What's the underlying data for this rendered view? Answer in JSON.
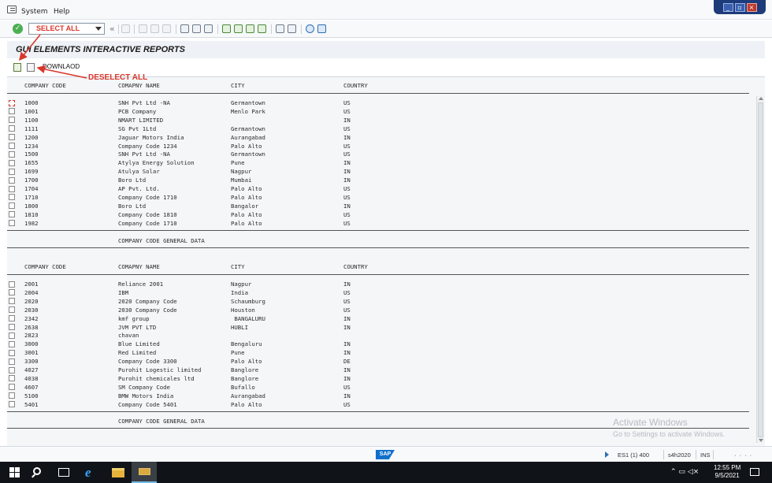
{
  "menu": {
    "items": [
      "System",
      "Help"
    ]
  },
  "toolbar": {
    "command_field_value": "SELECT ALL"
  },
  "title": "GUI ELEMENTS INTERACTIVE REPORTS",
  "app_toolbar": {
    "download_label": "DOWNLAOD"
  },
  "annotations": {
    "select_all": "SELECT ALL",
    "deselect_all": "DESELECT ALL"
  },
  "report": {
    "headers": [
      "COMPANY CODE",
      "COMAPNY NAME",
      "CITY",
      "COUNTRY"
    ],
    "section_label": "COMPANY CODE GENERAL DATA",
    "block1": [
      [
        "1000",
        "SNH Pvt Ltd -NA",
        "Germantown",
        "US"
      ],
      [
        "1001",
        "PCB Company",
        "Menlo Park",
        "US"
      ],
      [
        "1100",
        "NMART LIMITED",
        "",
        "IN"
      ],
      [
        "1111",
        "SG Pvt 1Ltd",
        "Germantown",
        "US"
      ],
      [
        "1200",
        "Jaguar Motors India",
        "Aurangabad",
        "IN"
      ],
      [
        "1234",
        "Company Code 1234",
        "Palo Alto",
        "US"
      ],
      [
        "1500",
        "SNH Pvt Ltd -NA",
        "Germantown",
        "US"
      ],
      [
        "1655",
        "Atylya Energy Solution",
        "Pune",
        "IN"
      ],
      [
        "1699",
        "Atulya Solar",
        "Nagpur",
        "IN"
      ],
      [
        "1700",
        "Boro Ltd",
        "Mumbai",
        "IN"
      ],
      [
        "1704",
        "AP Pvt. Ltd.",
        "Palo Alto",
        "US"
      ],
      [
        "1710",
        "Company Code 1710",
        "Palo Alto",
        "US"
      ],
      [
        "1800",
        "Boro Ltd",
        "Bangalor",
        "IN"
      ],
      [
        "1810",
        "Company Code 1810",
        "Palo Alto",
        "US"
      ],
      [
        "1982",
        "Company Code 1710",
        "Palo Alto",
        "US"
      ]
    ],
    "block2": [
      [
        "2001",
        "Reliance 2001",
        "Nagpur",
        "IN"
      ],
      [
        "2004",
        "IBM",
        "India",
        "US"
      ],
      [
        "2020",
        "2020 Company Code",
        "Schaumburg",
        "US"
      ],
      [
        "2030",
        "2030 Company Code",
        "Houston",
        "US"
      ],
      [
        "2342",
        "kmf group",
        " BANGALURU",
        "IN"
      ],
      [
        "2638",
        "JVM PVT LTD",
        "HUBLI",
        "IN"
      ],
      [
        "2823",
        "chavan",
        "",
        ""
      ],
      [
        "3000",
        "Blue Limited",
        "Bengaluru",
        "IN"
      ],
      [
        "3001",
        "Red Limited",
        "Pune",
        "IN"
      ],
      [
        "3300",
        "Company Code 3300",
        "Palo Alto",
        "DE"
      ],
      [
        "4027",
        "Purohit Logestic limited",
        "Banglore",
        "IN"
      ],
      [
        "4038",
        "Purohit chemicales ltd",
        "Banglore",
        "IN"
      ],
      [
        "4607",
        "SM Company Code",
        "Bufallo",
        "US"
      ],
      [
        "5100",
        "BMW Motors India",
        "Aurangabad",
        "IN"
      ],
      [
        "5401",
        "Company Code 5401",
        "Palo Alto",
        "US"
      ]
    ]
  },
  "watermark": {
    "line1": "Activate Windows",
    "line2": "Go to Settings to activate Windows."
  },
  "statusbar": {
    "logo": "SAP",
    "system": "ES1 (1) 400",
    "server": "s4h2020",
    "mode": "INS"
  },
  "taskbar": {
    "time": "12:55 PM",
    "date": "9/5/2021"
  },
  "colors": {
    "annotation": "#d9362b",
    "title_bg": "#eef2f6",
    "report_bg": "#f4f6f8"
  }
}
